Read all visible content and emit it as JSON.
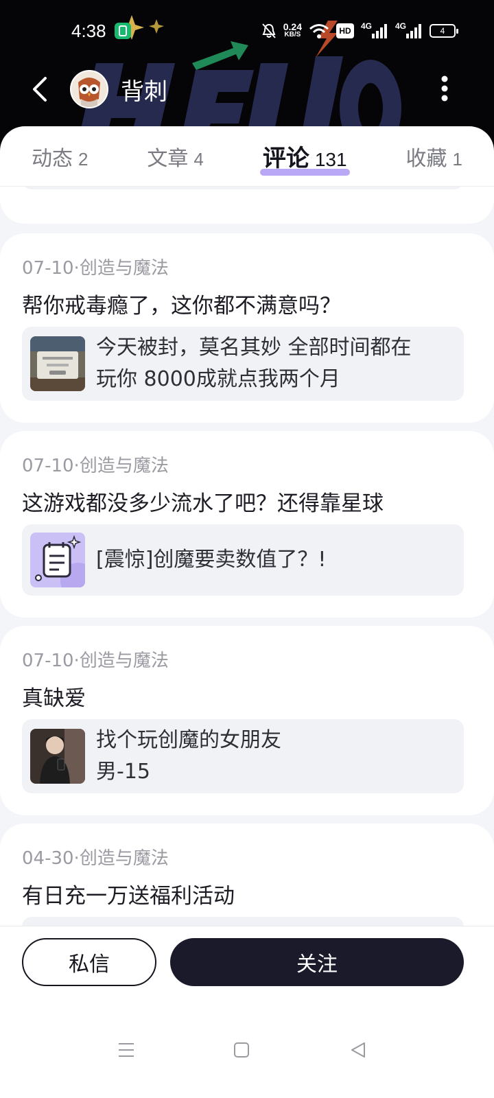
{
  "status": {
    "time": "4:38",
    "net_speed_value": "0.24",
    "net_speed_unit": "KB/S",
    "sim1": "4G",
    "sim2": "4G",
    "hd": "HD",
    "battery": "4"
  },
  "header": {
    "username": "背刺",
    "art_text": "HELLO."
  },
  "tabs": [
    {
      "name": "动态",
      "count": "2"
    },
    {
      "name": "文章",
      "count": "4"
    },
    {
      "name": "评论",
      "count": "131"
    },
    {
      "name": "收藏",
      "count": "1"
    }
  ],
  "comments": [
    {
      "meta": "07-10·创造与魔法",
      "text": "帮你戒毒瘾了，这你都不满意吗？",
      "quote_line1": "今天被封，莫名其妙 全部时间都在",
      "quote_line2": "玩你 8000成就点我两个月",
      "thumb": "screenshot-thumbnail"
    },
    {
      "meta": "07-10·创造与魔法",
      "text": "这游戏都没多少流水了吧？还得靠星球",
      "quote_line1": "[震惊]创魔要卖数值了？!",
      "quote_line2": "",
      "thumb": "article-icon"
    },
    {
      "meta": "07-10·创造与魔法",
      "text": "真缺爱",
      "quote_line1": "找个玩创魔的女朋友",
      "quote_line2": "男-15",
      "thumb": "person-photo"
    },
    {
      "meta": "04-30·创造与魔法",
      "text": "有日充一万送福利活动"
    }
  ],
  "actions": {
    "message": "私信",
    "follow": "关注"
  },
  "colors": {
    "accent": "#b9a8f5",
    "dark": "#1a1a2a",
    "header_bg": "#050508",
    "hello_art": "#2a2c55"
  }
}
